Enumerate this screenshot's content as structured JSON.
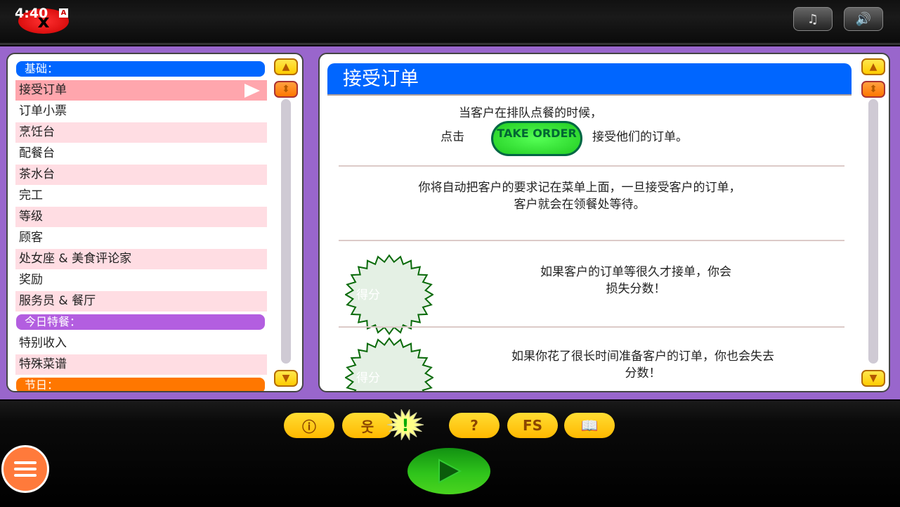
{
  "status": {
    "time": "4:40",
    "notification": "A"
  },
  "top": {
    "close_label": "x",
    "music_icon": "music-note-icon",
    "sound_icon": "speaker-icon"
  },
  "left": {
    "headers": [
      "基础：",
      "今日特餐：",
      "节日："
    ],
    "items": [
      "接受订单",
      "订单小票",
      "烹饪台",
      "配餐台",
      "茶水台",
      "完工",
      "等级",
      "顾客",
      "处女座 & 美食评论家",
      "奖励",
      "服务员 & 餐厅"
    ],
    "items2": [
      "特别收入",
      "特殊菜谱"
    ],
    "selected": "接受订单"
  },
  "content": {
    "title": "接受订单",
    "p1_line1": "当客户在排队点餐的时候，",
    "p1_click": "点击",
    "take_order_label": "TAKE ORDER",
    "p1_after": "接受他们的订单。",
    "p2_line1": "你将自动把客户的要求记在菜单上面，一旦接受客户的订单，",
    "p2_line2": "客户就会在领餐处等待。",
    "burst_label": "得分",
    "p3_line1": "如果客户的订单等很久才接单，你会",
    "p3_line2": "损失分数！",
    "p4_line1": "如果你花了很长时间准备客户的订单，你也会失去",
    "p4_line2": "分数！"
  },
  "toolbar": {
    "icons": [
      "info-icon",
      "customer-icon",
      "alert-icon",
      "help-icon",
      "fs-icon",
      "book-icon"
    ],
    "glyphs": [
      "ⓘ",
      "웃",
      "!",
      "?",
      "FS",
      "📖"
    ]
  },
  "colors": {
    "basics": "#0066ff",
    "specials": "#b35ee0",
    "holidays": "#ff7700",
    "selected": "#ffa6ad",
    "alt": "#ffdde3"
  }
}
